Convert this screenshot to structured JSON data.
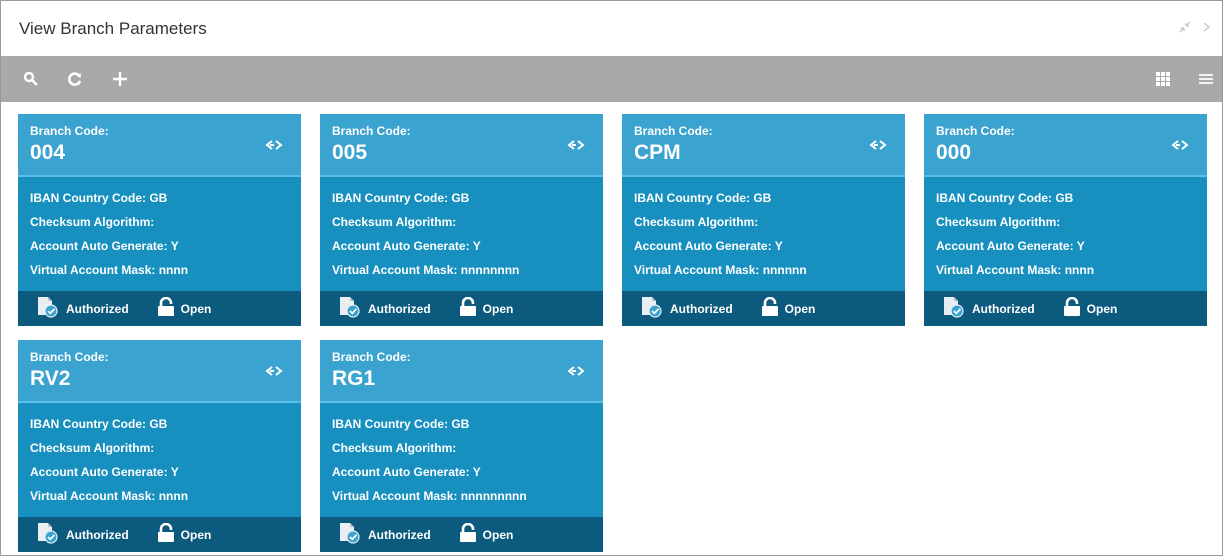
{
  "window": {
    "title": "View Branch Parameters"
  },
  "toolbar": {
    "left_icons": [
      "search-icon",
      "refresh-icon",
      "add-icon"
    ],
    "right_icons": [
      "grid-view-icon",
      "list-view-icon"
    ]
  },
  "colors": {
    "header": "#3ba3d0",
    "body": "#1790c0",
    "footer": "#0c5a7d",
    "toolbar": "#a9a9a9"
  },
  "card_labels": {
    "code": "Branch Code:",
    "iban": "IBAN Country Code:",
    "checksum": "Checksum Algorithm:",
    "auto": "Account Auto Generate:",
    "mask": "Virtual Account Mask:"
  },
  "cards": [
    {
      "code": "004",
      "iban": "GB",
      "checksum": "",
      "auto": "Y",
      "mask": "nnnn",
      "auth": "Authorized",
      "status": "Open"
    },
    {
      "code": "005",
      "iban": "GB",
      "checksum": "",
      "auto": "Y",
      "mask": "nnnnnnnn",
      "auth": "Authorized",
      "status": "Open"
    },
    {
      "code": "CPM",
      "iban": "GB",
      "checksum": "",
      "auto": "Y",
      "mask": "nnnnnn",
      "auth": "Authorized",
      "status": "Open"
    },
    {
      "code": "000",
      "iban": "GB",
      "checksum": "",
      "auto": "Y",
      "mask": "nnnn",
      "auth": "Authorized",
      "status": "Open"
    },
    {
      "code": "RV2",
      "iban": "GB",
      "checksum": "",
      "auto": "Y",
      "mask": "nnnn",
      "auth": "Authorized",
      "status": "Open"
    },
    {
      "code": "RG1",
      "iban": "GB",
      "checksum": "",
      "auto": "Y",
      "mask": "nnnnnnnnn",
      "auth": "Authorized",
      "status": "Open"
    }
  ]
}
